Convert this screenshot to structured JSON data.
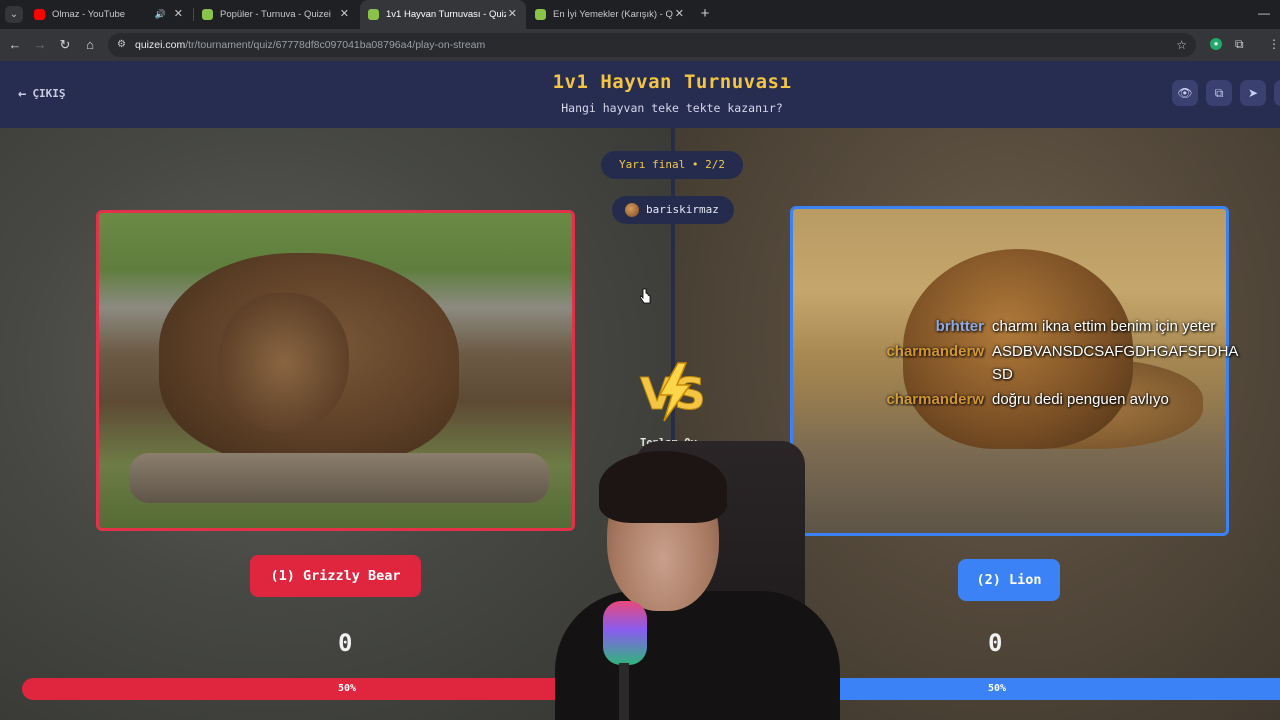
{
  "browser": {
    "tabs": [
      {
        "title": "Olmaz - YouTube",
        "favicon_color": "#ff0000",
        "audio": true
      },
      {
        "title": "Popüler - Turnuva - Quizei",
        "favicon_color": "#8bc34a"
      },
      {
        "title": "1v1 Hayvan Turnuvası - Quizei",
        "favicon_color": "#8bc34a",
        "active": true
      },
      {
        "title": "En İyi Yemekler (Karışık) - Quizei",
        "favicon_color": "#8bc34a"
      }
    ],
    "url_host": "quizei.com",
    "url_path": "/tr/tournament/quiz/67778df8c097041ba08796a4/play-on-stream"
  },
  "header": {
    "exit_label": "ÇIKIŞ",
    "title": "1v1 Hayvan Turnuvası",
    "subtitle": "Hangi hayvan teke tekte kazanır?",
    "buttons": [
      "eye-icon",
      "external-link-icon",
      "send-icon"
    ]
  },
  "round": {
    "label": "Yarı final • 2/2"
  },
  "user": {
    "name": "bariskirmaz"
  },
  "matchup": {
    "left": {
      "label": "(1) Grizzly Bear",
      "score": "0",
      "percent_label": "50%",
      "percent": 50,
      "color": "#e0253f"
    },
    "right": {
      "label": "(2) Lion",
      "score": "0",
      "percent_label": "50%",
      "percent": 50,
      "color": "#3b82f6"
    },
    "vs_label": "VS",
    "total_label": "Toplam Oy"
  },
  "chat": [
    {
      "user": "brhtter",
      "user_color": "#8fb4ff",
      "message": "charmı ikna ettim benim için yeter"
    },
    {
      "user": "charmanderw",
      "user_color": "#e0a030",
      "message": "ASDBVANSDCSAFGDHGAFSFDHA"
    },
    {
      "user": "",
      "user_color": "#e0a030",
      "message": "SD"
    },
    {
      "user": "charmanderw",
      "user_color": "#e0a030",
      "message": "doğru dedi penguen avlıyo"
    }
  ]
}
